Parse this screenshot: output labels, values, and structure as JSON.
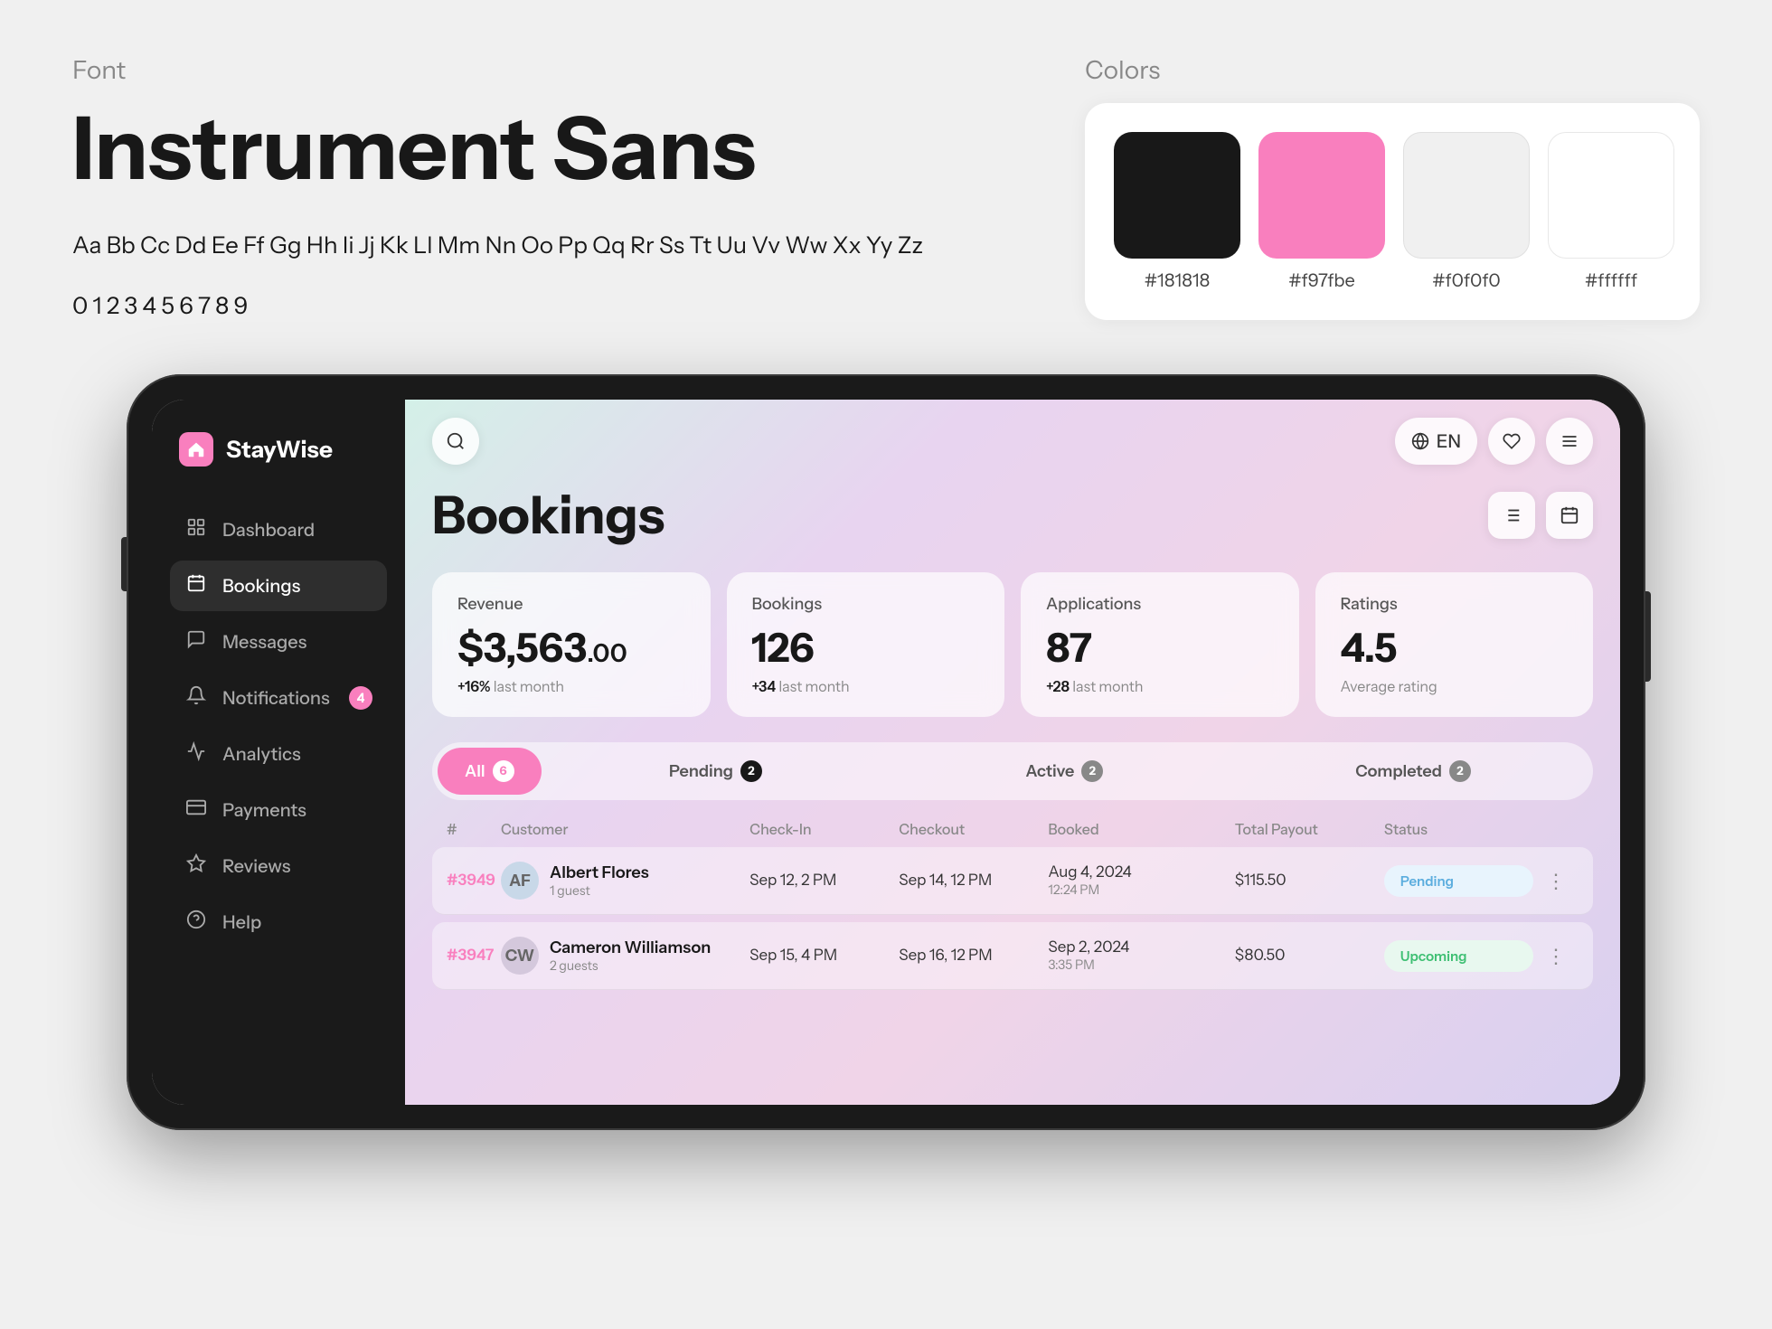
{
  "font": {
    "label": "Font",
    "name": "Instrument Sans",
    "alphabet": "Aa Bb Cc Dd Ee Ff Gg Hh Ii Jj Kk Ll Mm Nn Oo Pp Qq Rr Ss Tt Uu Vv Ww Xx Yy Zz",
    "numbers": "0 1 2 3 4 5 6 7 8 9"
  },
  "colors": {
    "label": "Colors",
    "swatches": [
      {
        "hex": "#181818",
        "label": "#181818"
      },
      {
        "hex": "#f97fbe",
        "label": "#f97fbe"
      },
      {
        "hex": "#f0f0f0",
        "label": "#f0f0f0"
      },
      {
        "hex": "#ffffff",
        "label": "#ffffff"
      }
    ]
  },
  "app": {
    "logo_text": "StayWise",
    "header": {
      "lang": "EN",
      "search_placeholder": "Search"
    },
    "sidebar": {
      "items": [
        {
          "id": "dashboard",
          "label": "Dashboard",
          "icon": "📊",
          "active": false
        },
        {
          "id": "bookings",
          "label": "Bookings",
          "icon": "📋",
          "active": true
        },
        {
          "id": "messages",
          "label": "Messages",
          "icon": "💬",
          "active": false
        },
        {
          "id": "notifications",
          "label": "Notifications",
          "icon": "🔔",
          "active": false,
          "badge": "4"
        },
        {
          "id": "analytics",
          "label": "Analytics",
          "icon": "📈",
          "active": false
        },
        {
          "id": "payments",
          "label": "Payments",
          "icon": "💳",
          "active": false
        },
        {
          "id": "reviews",
          "label": "Reviews",
          "icon": "⭐",
          "active": false
        },
        {
          "id": "help",
          "label": "Help",
          "icon": "❓",
          "active": false
        }
      ]
    },
    "page": {
      "title": "Bookings",
      "stats": [
        {
          "label": "Revenue",
          "value": "$3,563",
          "cents": ".00",
          "change": "+16%",
          "change_label": "last month"
        },
        {
          "label": "Bookings",
          "value": "126",
          "change": "+34",
          "change_label": "last month"
        },
        {
          "label": "Applications",
          "value": "87",
          "change": "+28",
          "change_label": "last month"
        },
        {
          "label": "Ratings",
          "value": "4.5",
          "change": "Average rating"
        }
      ],
      "filter_tabs": [
        {
          "id": "all",
          "label": "All",
          "count": "6",
          "active": true
        },
        {
          "id": "pending",
          "label": "Pending",
          "count": "2",
          "active": false
        },
        {
          "id": "active",
          "label": "Active",
          "count": "2",
          "active": false
        },
        {
          "id": "completed",
          "label": "Completed",
          "count": "2",
          "active": false
        }
      ],
      "table": {
        "headers": [
          "#",
          "Customer",
          "Check-In",
          "Checkout",
          "Booked",
          "Total Payout",
          "Status",
          ""
        ],
        "rows": [
          {
            "id": "#3949",
            "customer_name": "Albert Flores",
            "customer_guests": "1 guest",
            "avatar_initials": "AF",
            "avatar_color": "#b8cce4",
            "checkin": "Sep 12, 2 PM",
            "checkout": "Sep 14, 12 PM",
            "booked": "Aug 4, 2024",
            "booked_time": "12:24 PM",
            "payout": "$115.50",
            "status": "Pending",
            "status_class": "status-pending"
          },
          {
            "id": "#3947",
            "customer_name": "Cameron Williamson",
            "customer_guests": "2 guests",
            "avatar_initials": "CW",
            "avatar_color": "#c8b8d4",
            "checkin": "Sep 15, 4 PM",
            "checkout": "Sep 16, 12 PM",
            "booked": "Sep 2, 2024",
            "booked_time": "3:35 PM",
            "payout": "$80.50",
            "status": "Upcoming",
            "status_class": "status-upcoming"
          }
        ]
      }
    }
  }
}
